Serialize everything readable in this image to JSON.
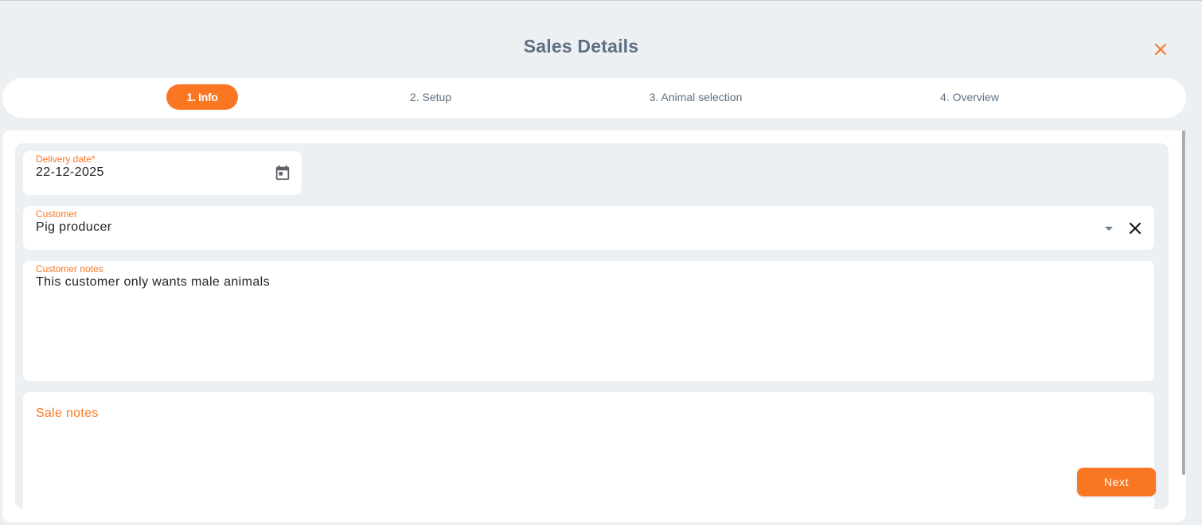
{
  "modal": {
    "title": "Sales Details"
  },
  "steps": [
    {
      "label": "1. Info",
      "active": true
    },
    {
      "label": "2. Setup",
      "active": false
    },
    {
      "label": "3. Animal selection",
      "active": false
    },
    {
      "label": "4. Overview",
      "active": false
    }
  ],
  "form": {
    "delivery_date": {
      "label": "Delivery date*",
      "value": "22-12-2025"
    },
    "customer": {
      "label": "Customer",
      "value": "Pig producer"
    },
    "customer_notes": {
      "label": "Customer notes",
      "value": "This customer only wants male animals"
    },
    "sale_notes": {
      "label": "Sale notes",
      "value": ""
    }
  },
  "actions": {
    "next_label": "Next"
  },
  "icons": {
    "close": "close-icon",
    "calendar": "calendar-icon",
    "dropdown": "caret-down-icon",
    "clear": "clear-icon"
  },
  "colors": {
    "accent": "#f97722",
    "title": "#5d6f82",
    "background": "#edf0f3",
    "surface": "#ffffff"
  }
}
